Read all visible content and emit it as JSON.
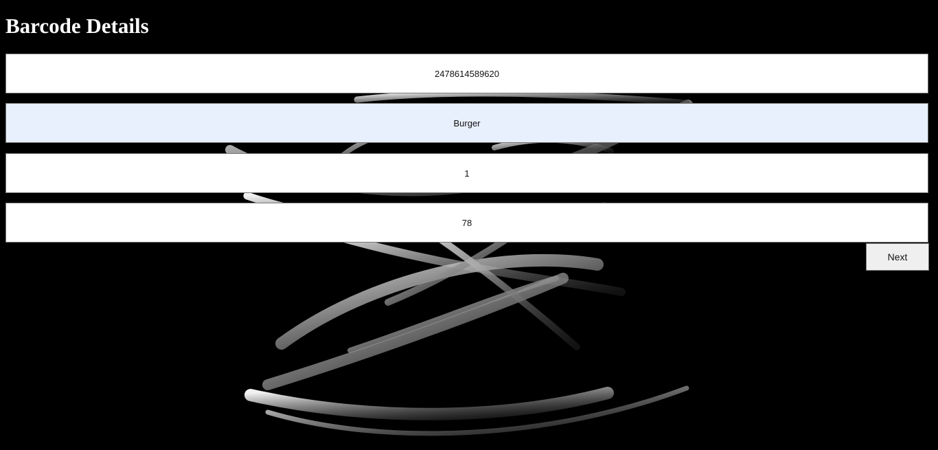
{
  "page": {
    "title": "Barcode Details"
  },
  "form": {
    "barcode_value": "2478614589620",
    "product_name_value": "Burger",
    "quantity_value": "1",
    "price_value": "78",
    "next_label": "Next"
  },
  "colors": {
    "background": "#000000",
    "field": "#ffffff",
    "autofilled_field": "#e8f0fe",
    "button": "#efefef"
  },
  "background_art": {
    "icon": "abstract-swirl-ribbons"
  }
}
